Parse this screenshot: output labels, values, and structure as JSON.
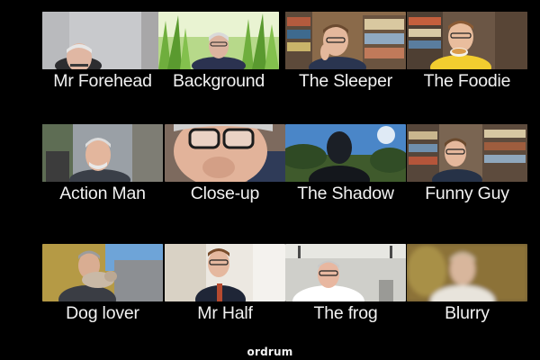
{
  "tiles": [
    {
      "label": "Mr Forehead"
    },
    {
      "label": "Background"
    },
    {
      "label": "The Sleeper"
    },
    {
      "label": "The Foodie"
    },
    {
      "label": "Action Man"
    },
    {
      "label": "Close-up"
    },
    {
      "label": "The Shadow"
    },
    {
      "label": "Funny Guy"
    },
    {
      "label": "Dog lover"
    },
    {
      "label": "Mr Half"
    },
    {
      "label": "The frog"
    },
    {
      "label": "Blurry"
    }
  ],
  "brand": {
    "text": "ordrum"
  },
  "colors": {
    "background": "#000000",
    "caption": "#f2f2f2"
  }
}
